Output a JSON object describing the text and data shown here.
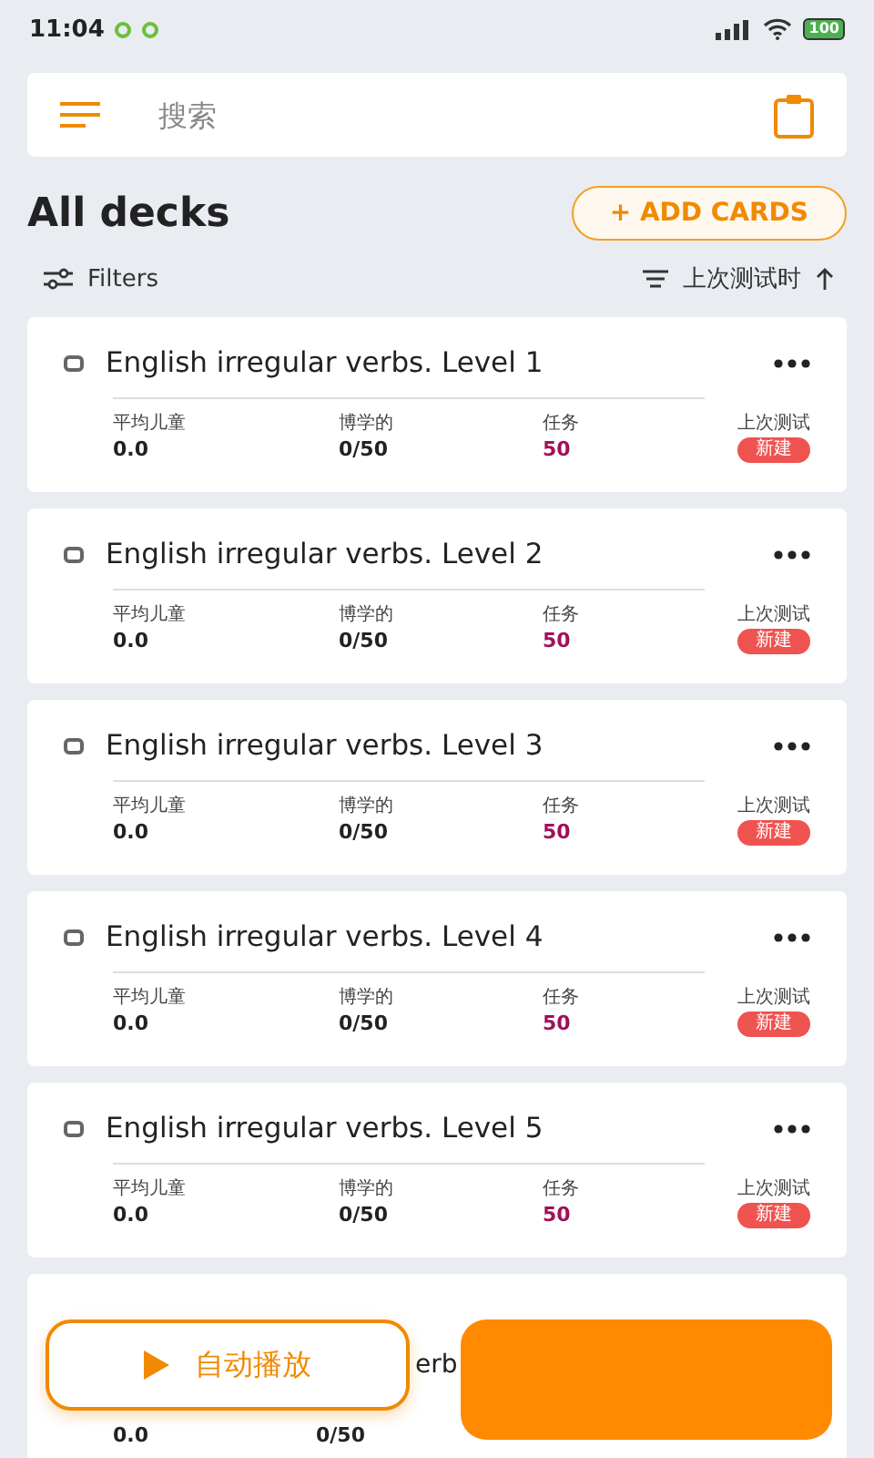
{
  "status_bar": {
    "time": "11:04",
    "battery": "100"
  },
  "search": {
    "placeholder": "搜索"
  },
  "header": {
    "title": "All decks",
    "add_button": "+ ADD CARDS"
  },
  "toolbar": {
    "filters": "Filters",
    "sort": "上次测试时"
  },
  "decks": [
    {
      "kind": "full",
      "title": "English irregular verbs. Level 1",
      "stats": [
        {
          "label": "平均儿童",
          "value": "0.0"
        },
        {
          "label": "博学的",
          "value": "0/50"
        },
        {
          "label": "任务",
          "value": "50"
        }
      ],
      "last_label": "上次测试",
      "badge": "新建"
    },
    {
      "kind": "full",
      "title": "English irregular verbs. Level 2",
      "stats": [
        {
          "label": "平均儿童",
          "value": "0.0"
        },
        {
          "label": "博学的",
          "value": "0/50"
        },
        {
          "label": "任务",
          "value": "50"
        }
      ],
      "last_label": "上次测试",
      "badge": "新建"
    },
    {
      "kind": "full",
      "title": "English irregular verbs. Level 3",
      "stats": [
        {
          "label": "平均儿童",
          "value": "0.0"
        },
        {
          "label": "博学的",
          "value": "0/50"
        },
        {
          "label": "任务",
          "value": "50"
        }
      ],
      "last_label": "上次测试",
      "badge": "新建"
    },
    {
      "kind": "full",
      "title": "English irregular verbs. Level 4",
      "stats": [
        {
          "label": "平均儿童",
          "value": "0.0"
        },
        {
          "label": "博学的",
          "value": "0/50"
        },
        {
          "label": "任务",
          "value": "50"
        }
      ],
      "last_label": "上次测试",
      "badge": "新建"
    },
    {
      "kind": "full",
      "title": "English irregular verbs. Level 5",
      "stats": [
        {
          "label": "平均儿童",
          "value": "0.0"
        },
        {
          "label": "博学的",
          "value": "0/50"
        },
        {
          "label": "任务",
          "value": "50"
        }
      ],
      "last_label": "上次测试",
      "badge": "新建"
    },
    {
      "kind": "covered",
      "title": "erb",
      "stats": [
        {
          "value": "0.0"
        },
        {
          "value": "0/50"
        }
      ]
    }
  ],
  "autoplay_button": "自动播放"
}
